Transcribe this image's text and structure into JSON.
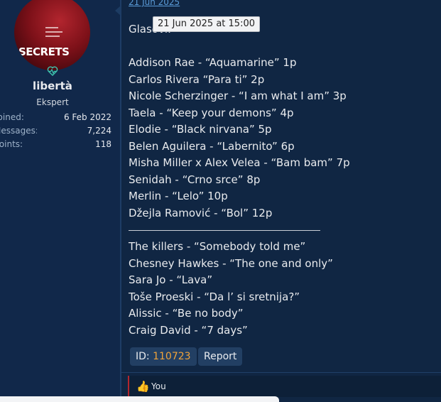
{
  "user": {
    "avatar_text": "SECRETS",
    "name": "libertà",
    "title": "Ekspert",
    "stats": [
      {
        "label": "Joined:",
        "value": "6 Feb 2022"
      },
      {
        "label": "Messages:",
        "value": "7,224"
      },
      {
        "label": "Points:",
        "value": "118"
      }
    ]
  },
  "post": {
    "date": "21 Jun 2025",
    "tooltip": "21 Jun 2025 at 15:00",
    "intro": "Glasovi:",
    "votes": [
      "Addison Rae - “Aquamarine” 1p",
      "Carlos Rivera “Para ti” 2p",
      "Nicole Scherzinger - “I am what I am” 3p",
      "Taela - “Keep your demons” 4p",
      "Elodie - “Black nirvana” 5p",
      "Belen Aguilera - “Labernito” 6p",
      "Misha Miller x Alex Velea - “Bam bam” 7p",
      "Senidah - “Crno srce” 8p",
      "Merlin - “Lelo” 10p",
      "Džejla Ramović - “Bol” 12p"
    ],
    "extras": [
      "The killers - “Somebody told me”",
      "Chesney Hawkes - “The one and only”",
      "Sara Jo - “Lava”",
      "Toše Proeski - “Da l’ si sretnija?”",
      "Alissic - “Be no body”",
      "Craig David - “7 days”"
    ],
    "id_label": "ID:",
    "id_value": "110723",
    "report_label": "Report",
    "reaction_text": "You",
    "reaction_icon": "thumbs-up-icon"
  },
  "colors": {
    "background": "#102643",
    "sidebar": "#11284a",
    "link": "#5a9bd8",
    "id_accent": "#f0a33a",
    "reaction_bar": "#b3262d"
  }
}
